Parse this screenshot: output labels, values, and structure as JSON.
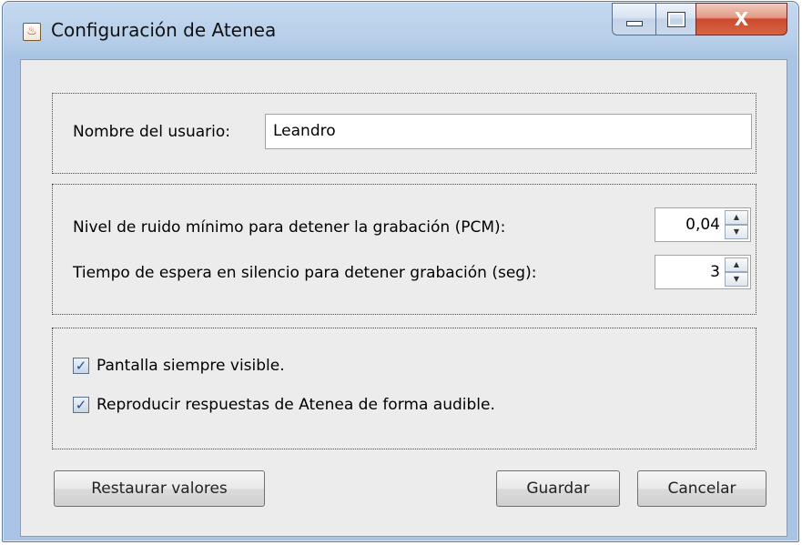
{
  "window": {
    "title": "Configuración de Atenea",
    "controls": {
      "minimize": "minimize",
      "maximize": "maximize",
      "close": "X"
    }
  },
  "user_panel": {
    "username_label": "Nombre del usuario:",
    "username_value": "Leandro"
  },
  "recording_panel": {
    "noise_label": "Nivel de ruido mínimo para detener la grabación (PCM):",
    "noise_value": "0,04",
    "silence_label": "Tiempo de espera en silencio para detener grabación (seg):",
    "silence_value": "3"
  },
  "options_panel": {
    "always_visible_label": "Pantalla siempre visible.",
    "always_visible_checked": true,
    "audible_label": "Reproducir respuestas de Atenea de forma audible.",
    "audible_checked": true
  },
  "buttons": {
    "restore": "Restaurar valores",
    "save": "Guardar",
    "cancel": "Cancelar"
  },
  "icons": {
    "app": "java-app-icon",
    "spin_up": "▲",
    "spin_down": "▼",
    "check": "✓"
  }
}
